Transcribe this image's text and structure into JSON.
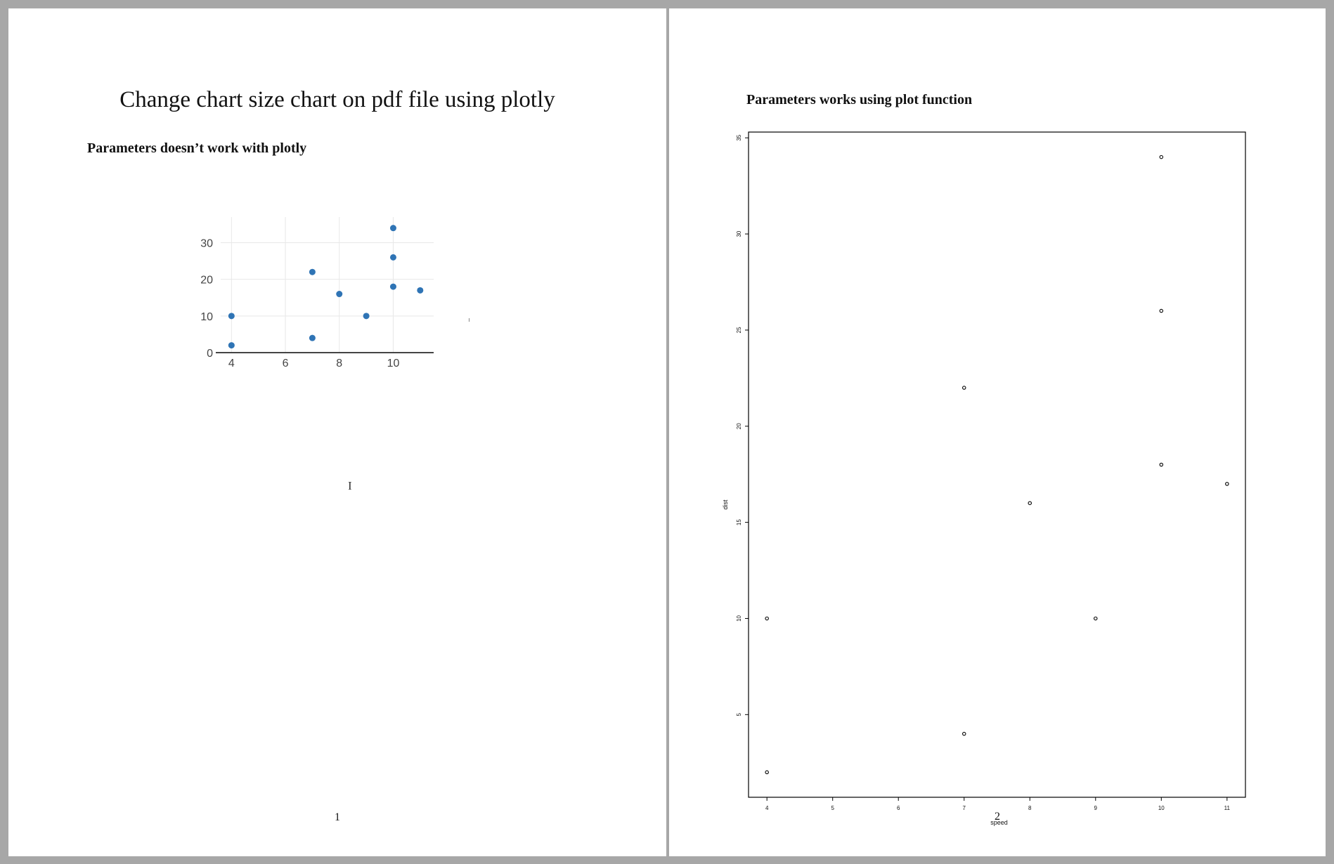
{
  "document": {
    "title": "Change chart size chart on pdf file using plotly",
    "page1": {
      "section_title": "Parameters doesn’t work with plotly",
      "artifact_glyph": "I",
      "page_number": "1"
    },
    "page2": {
      "section_title": "Parameters works using plot function",
      "page_number": "2"
    }
  },
  "colors": {
    "page_background": "#ffffff",
    "viewer_background": "#a7a7a7",
    "plotly_marker": "#2f74b5",
    "plotly_grid": "#e8e8e8",
    "base_plot_ink": "#000000"
  },
  "chart_data": [
    {
      "type": "scatter",
      "renderer": "plotly",
      "title": "",
      "xlabel": "",
      "ylabel": "",
      "x_ticks": [
        "4",
        "6",
        "8",
        "10"
      ],
      "y_ticks": [
        "0",
        "10",
        "20",
        "30"
      ],
      "xlim": [
        3.6,
        11.5
      ],
      "ylim": [
        0,
        37
      ],
      "grid": true,
      "legend": "none",
      "marker": "filled-circle",
      "x": [
        4,
        4,
        7,
        7,
        8,
        9,
        10,
        10,
        10,
        11
      ],
      "y": [
        2,
        10,
        4,
        22,
        16,
        10,
        18,
        26,
        34,
        17
      ]
    },
    {
      "type": "scatter",
      "renderer": "base-r-plot",
      "title": "",
      "xlabel": "speed",
      "ylabel": "dist",
      "x_ticks": [
        "4",
        "5",
        "6",
        "7",
        "8",
        "9",
        "10",
        "11"
      ],
      "y_ticks": [
        "5",
        "10",
        "15",
        "20",
        "25",
        "30",
        "35"
      ],
      "xlim": [
        3.72,
        11.28
      ],
      "ylim": [
        0.7,
        35.3
      ],
      "grid": false,
      "legend": "none",
      "marker": "open-circle",
      "box": true,
      "x": [
        4,
        4,
        7,
        7,
        8,
        9,
        10,
        10,
        10,
        11
      ],
      "y": [
        2,
        10,
        4,
        22,
        16,
        10,
        18,
        26,
        34,
        17
      ]
    }
  ]
}
